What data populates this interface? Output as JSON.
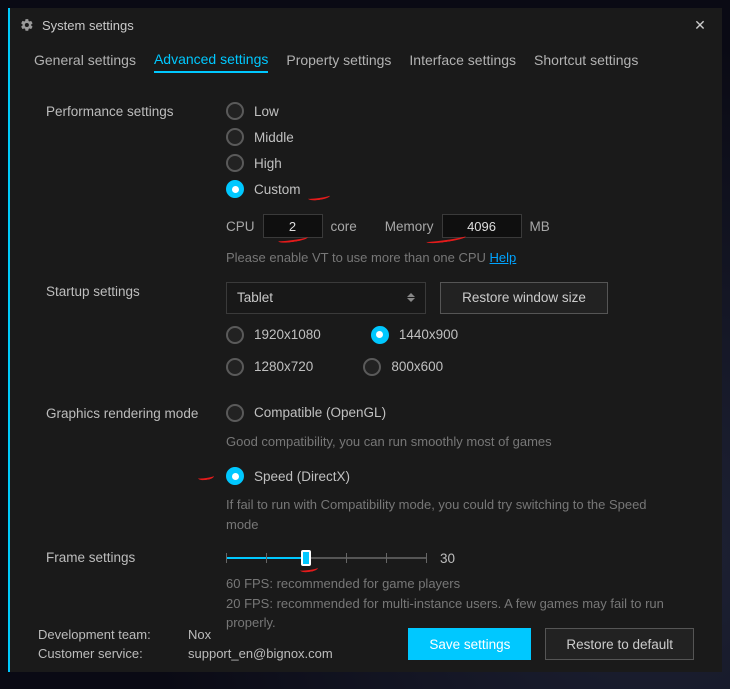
{
  "title": "System settings",
  "tabs": [
    "General settings",
    "Advanced settings",
    "Property settings",
    "Interface settings",
    "Shortcut settings"
  ],
  "activeTab": 1,
  "perf": {
    "label": "Performance settings",
    "options": [
      "Low",
      "Middle",
      "High",
      "Custom"
    ],
    "selected": 3,
    "cpu_label": "CPU",
    "cpu_value": "2",
    "core_label": "core",
    "mem_label": "Memory",
    "mem_value": "4096",
    "mb_label": "MB",
    "vt_hint": "Please enable VT to use more than one CPU",
    "help": "Help"
  },
  "startup": {
    "label": "Startup settings",
    "selected": "Tablet",
    "restore": "Restore window size",
    "res": [
      "1920x1080",
      "1440x900",
      "1280x720",
      "800x600"
    ],
    "res_selected": 1
  },
  "graphics": {
    "label": "Graphics rendering mode",
    "opt_compat": "Compatible (OpenGL)",
    "compat_hint": "Good compatibility, you can run smoothly most of games",
    "opt_speed": "Speed (DirectX)",
    "speed_hint": " If fail to run with Compatibility mode, you could try switching to the Speed mode",
    "selected": 1
  },
  "frame": {
    "label": "Frame settings",
    "value": "30",
    "hint1": "60 FPS: recommended for game players",
    "hint2": "20 FPS: recommended for multi-instance users. A few games may fail to run properly."
  },
  "footer": {
    "dev_label": "Development team:",
    "dev_value": "Nox",
    "cs_label": "Customer service:",
    "cs_value": "support_en@bignox.com",
    "save": "Save settings",
    "restore": "Restore to default"
  }
}
